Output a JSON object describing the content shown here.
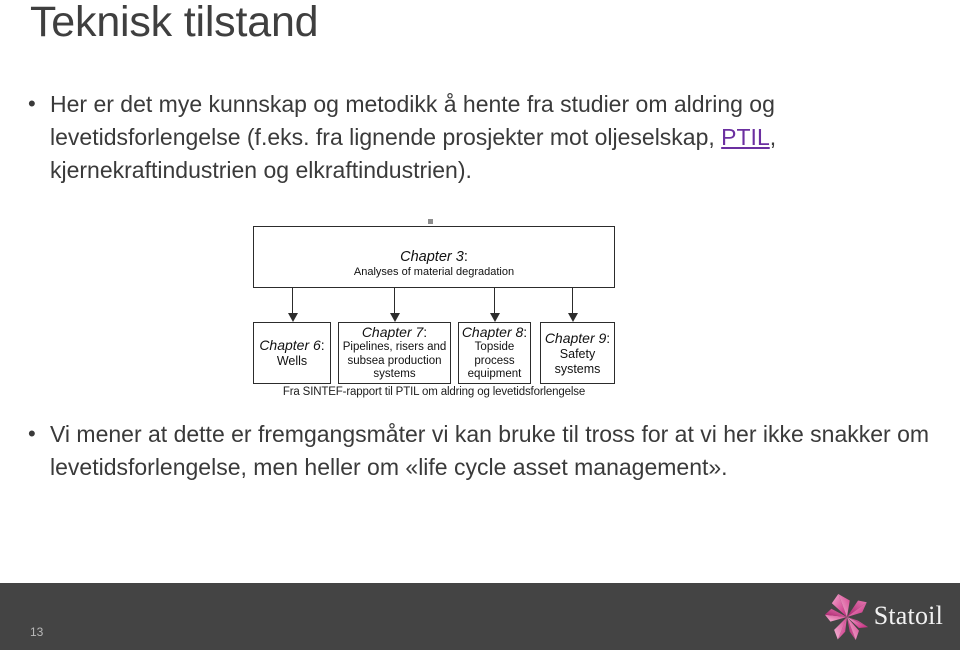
{
  "slide": {
    "title": "Teknisk tilstand",
    "page_number": "13",
    "footer_bg": "#444444",
    "link_color": "#6b2fa0"
  },
  "bullets": {
    "dot": "•",
    "first": {
      "pre": "Her er det mye kunnskap og metodikk å hente fra studier om aldring og levetidsforlengelse (f.eks. fra lignende prosjekter mot oljeselskap, ",
      "link": "PTIL",
      "post": ", kjernekraftindustrien og elkraftindustrien)."
    },
    "second": {
      "text": "Vi mener at dette er fremgangsmåter vi kan bruke til tross for at vi her ikke snakker om levetidsforlengelse, men heller om «life cycle asset management»."
    }
  },
  "diagram": {
    "top_box": {
      "chapter": "Chapter 3",
      "colon": ":",
      "subtitle": "Analyses of material degradation"
    },
    "boxes": [
      {
        "chapter": "Chapter 6",
        "colon": ":",
        "subtitle": "Wells"
      },
      {
        "chapter": "Chapter 7",
        "colon": ":",
        "subtitle": "Pipelines, risers and subsea production systems"
      },
      {
        "chapter": "Chapter 8",
        "colon": ":",
        "subtitle": "Topside process equipment"
      },
      {
        "chapter": "Chapter 9",
        "colon": ":",
        "subtitle": "Safety systems"
      }
    ],
    "caption": "Fra SINTEF-rapport til PTIL om aldring og levetidsforlengelse"
  },
  "logo": {
    "word": "Statoil",
    "star_color": "#e0609f"
  }
}
